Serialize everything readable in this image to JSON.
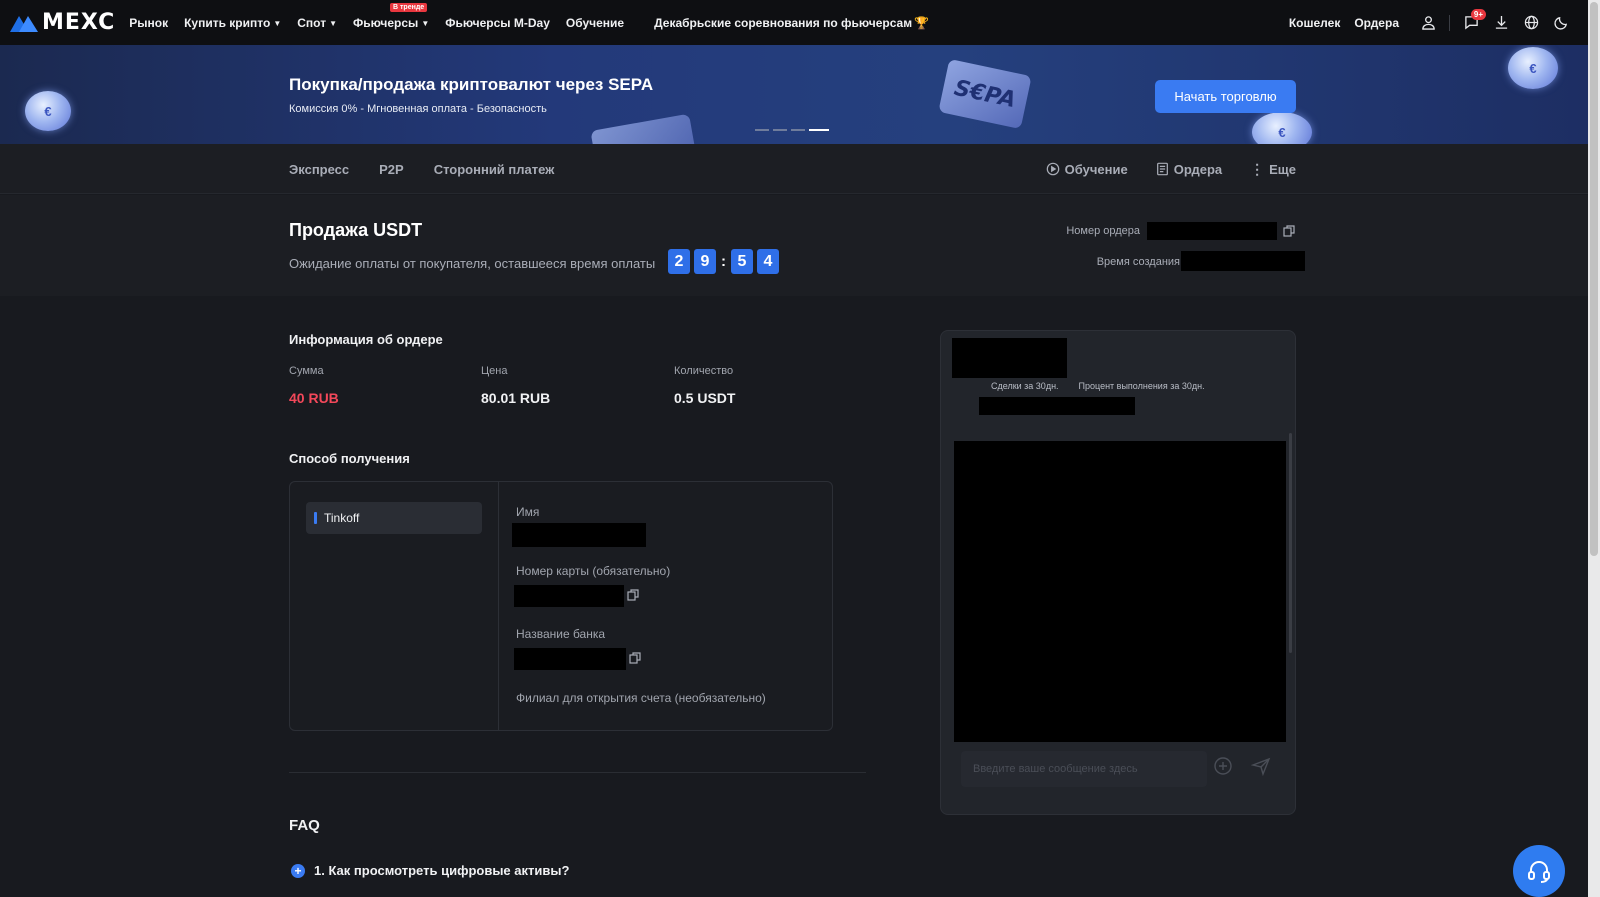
{
  "nav": {
    "logo_text": "MEXC",
    "items": [
      {
        "label": "Рынок",
        "dropdown": false
      },
      {
        "label": "Купить крипто",
        "dropdown": true
      },
      {
        "label": "Спот",
        "dropdown": true
      },
      {
        "label": "Фьючерсы",
        "dropdown": true,
        "badge": "В тренде"
      },
      {
        "label": "Фьючерсы M-Day",
        "dropdown": false
      },
      {
        "label": "Обучение",
        "dropdown": false
      }
    ],
    "promo": "Декабрьские соревнования по фьючерсам",
    "promo_icon": "trophy-icon",
    "right_items": [
      "Кошелек",
      "Ордера"
    ],
    "notification_count": "9+"
  },
  "banner": {
    "title": "Покупка/продажа криптовалют через SEPA",
    "subtitle": "Комиссия 0% - Мгновенная оплата - Безопасность",
    "button": "Начать торговлю",
    "card_text": "S€PA",
    "card_text_2": "PA",
    "slide_count": 4,
    "active_slide": 4
  },
  "subnav": {
    "tabs": [
      "Экспресс",
      "P2P",
      "Сторонний платеж"
    ],
    "right": [
      "Обучение",
      "Ордера",
      "Еще"
    ]
  },
  "order": {
    "title": "Продажа USDT",
    "waiting_text": "Ожидание оплаты от покупателя, оставшееся время оплаты",
    "timer": {
      "m1": "2",
      "m2": "9",
      "separator": ":",
      "s1": "5",
      "s2": "4"
    },
    "order_number_label": "Номер ордера",
    "created_label": "Время создания"
  },
  "order_info": {
    "title": "Информация об ордере",
    "amount_label": "Сумма",
    "amount_value": "40 RUB",
    "price_label": "Цена",
    "price_value": "80.01 RUB",
    "qty_label": "Количество",
    "qty_value": "0.5 USDT"
  },
  "payment": {
    "title": "Способ получения",
    "method": "Tinkoff",
    "name_label": "Имя",
    "card_label": "Номер карты (обязательно)",
    "bank_label": "Название банка",
    "branch_label": "Филиал для открытия счета (необязательно)"
  },
  "faq": {
    "title": "FAQ",
    "items": [
      "1. Как просмотреть цифровые активы?"
    ]
  },
  "chat": {
    "stat1": "Сделки за 30дн.",
    "stat2": "Процент выполнения за 30дн.",
    "input_placeholder": "Введите ваше сообщение здесь"
  },
  "colors": {
    "accent": "#3a7bf2",
    "sell_red": "#f3485a",
    "background": "#181a1f",
    "panel": "#1c1e23"
  }
}
